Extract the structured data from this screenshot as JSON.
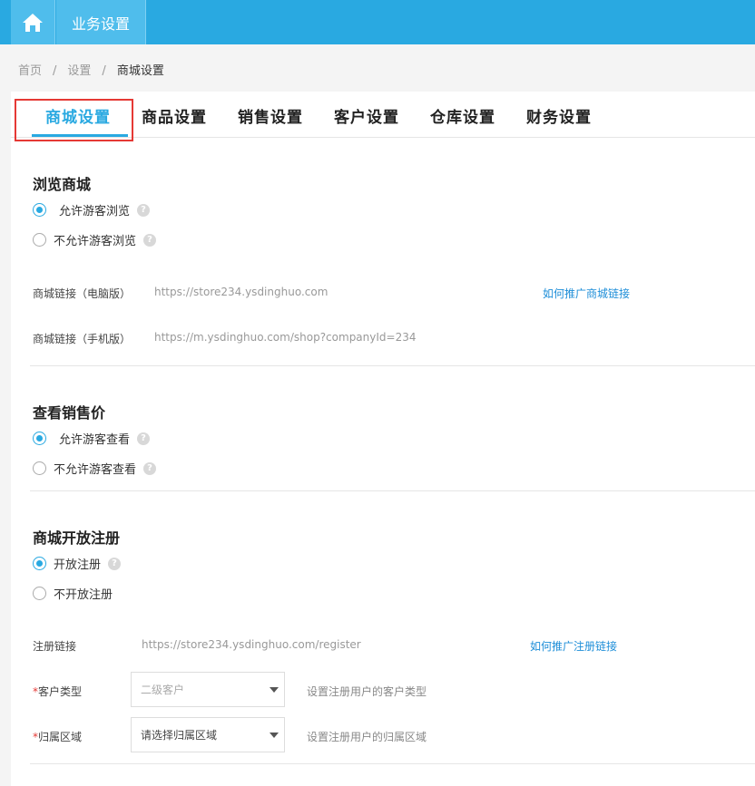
{
  "topbar": {
    "module_tab": "业务设置"
  },
  "breadcrumb": {
    "home": "首页",
    "sep1": "/",
    "settings": "设置",
    "sep2": "/",
    "current": "商城设置"
  },
  "tabs": [
    {
      "label": "商城设置",
      "active": true
    },
    {
      "label": "商品设置"
    },
    {
      "label": "销售设置"
    },
    {
      "label": "客户设置"
    },
    {
      "label": "仓库设置"
    },
    {
      "label": "财务设置"
    }
  ],
  "browse": {
    "title": "浏览商城",
    "option_allow": "允许游客浏览",
    "option_deny": "不允许游客浏览",
    "pc_link_label": "商城链接（电脑版）",
    "pc_link_value": "https://store234.ysdinghuo.com",
    "promote_link": "如何推广商城链接",
    "mobile_link_label": "商城链接（手机版）",
    "mobile_link_value": "https://m.ysdinghuo.com/shop?companyId=234"
  },
  "price": {
    "title": "查看销售价",
    "option_allow": "允许游客查看",
    "option_deny": "不允许游客查看"
  },
  "register": {
    "title": "商城开放注册",
    "option_open": "开放注册",
    "option_closed": "不开放注册",
    "link_label": "注册链接",
    "link_value": "https://store234.ysdinghuo.com/register",
    "promote_link": "如何推广注册链接",
    "required_mark": "*",
    "customer_type_label": "客户类型",
    "customer_type_value": "二级客户",
    "customer_type_hint": "设置注册用户的客户类型",
    "region_label": "归属区域",
    "region_value": "请选择归属区域",
    "region_hint": "设置注册用户的归属区域"
  },
  "icons": {
    "home": "home-icon",
    "help": "question-icon",
    "dropdown": "caret-down-icon"
  },
  "colors": {
    "accent": "#29a9e1",
    "highlight": "#e53935"
  }
}
